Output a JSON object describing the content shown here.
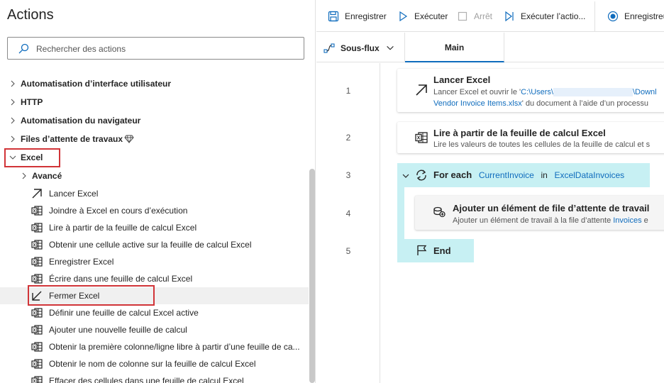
{
  "actions_pane": {
    "title": "Actions",
    "search_placeholder": "Rechercher des actions",
    "categories": [
      "Automatisation d’interface utilisateur",
      "HTTP",
      "Automatisation du navigateur",
      "Files d’attente de travaux",
      "Excel"
    ],
    "excel_subgroup": "Avancé",
    "excel_actions": [
      "Lancer Excel",
      "Joindre à Excel en cours d’exécution",
      "Lire à partir de la feuille de calcul Excel",
      "Obtenir une cellule active sur la feuille de calcul Excel",
      "Enregistrer Excel",
      "Écrire dans une feuille de calcul Excel",
      "Fermer Excel",
      "Définir une feuille de calcul Excel active",
      "Ajouter une nouvelle feuille de calcul",
      "Obtenir la première colonne/ligne libre à partir d’une feuille de ca...",
      "Obtenir le nom de colonne sur la feuille de calcul Excel",
      "Effacer des cellules dans une feuille de calcul Excel"
    ]
  },
  "toolbar": {
    "save": "Enregistrer",
    "run": "Exécuter",
    "stop": "Arrêt",
    "run_action": "Exécuter l’actio...",
    "record": "Enregistreu"
  },
  "tabs": {
    "subflows": "Sous-flux",
    "main": "Main"
  },
  "lines": [
    "1",
    "2",
    "3",
    "4",
    "5"
  ],
  "steps": {
    "launch": {
      "title": "Lancer Excel",
      "desc_prefix": "Lancer Excel et ouvrir le '",
      "path_start": "C:\\Users\\",
      "path_end": "\\Downl",
      "file": "Vendor Invoice Items.xlsx",
      "desc_suffix": "' du document à l’aide d’un processu"
    },
    "read": {
      "title": "Lire à partir de la feuille de calcul Excel",
      "desc": "Lire les valeurs de toutes les cellules de la feuille de calcul et s"
    },
    "foreach": {
      "keyword": "For each",
      "var": "CurrentInvoice",
      "in": "in",
      "list": "ExcelDataInvoices"
    },
    "enqueue": {
      "title": "Ajouter un élément de file d’attente de travail",
      "desc_prefix": "Ajouter un élément de travail à la file d’attente ",
      "queue": "Invoices",
      "desc_suffix": " e"
    },
    "end": {
      "keyword": "End"
    }
  },
  "colors": {
    "accent": "#0f6cbd",
    "highlight_border": "#d13438",
    "loop_band": "#c7f0f3"
  }
}
